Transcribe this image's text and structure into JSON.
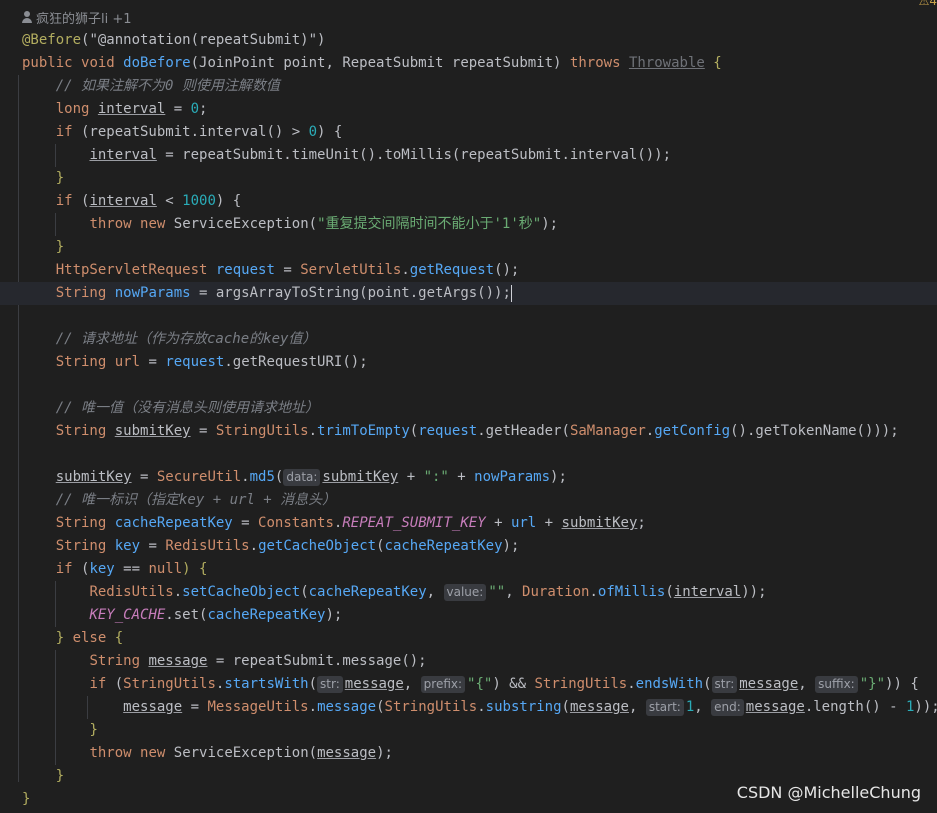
{
  "author": {
    "name": "疯狂的狮子li +1"
  },
  "warning_count": "4",
  "watermark": "CSDN @MichelleChung",
  "code": {
    "l1": {
      "ann": "@Before",
      "rest": "(\"@annotation(repeatSubmit)\")"
    },
    "l2": {
      "public": "public",
      "void": "void",
      "fn": "doBefore",
      "p1": "(JoinPoint point, RepeatSubmit repeatSubmit)",
      "throws": "throws",
      "thr": "Throwable",
      "brace": " {"
    },
    "l3": {
      "comment": "// 如果注解不为0 则使用注解数值"
    },
    "l4": {
      "long": "long",
      "var": "interval",
      "eq": " = ",
      "num": "0",
      "end": ";"
    },
    "l5": {
      "if": "if",
      "a": " (repeatSubmit.interval() > ",
      "num": "0",
      "b": ") {"
    },
    "l6": {
      "var": "interval",
      "a": " = repeatSubmit.timeUnit().toMillis(repeatSubmit.interval());"
    },
    "l7": {
      "text": "}"
    },
    "l8": {
      "if": "if",
      "a": " (",
      "var": "interval",
      "b": " < ",
      "num": "1000",
      "c": ") {"
    },
    "l9": {
      "throw": "throw",
      "new": "new",
      "a": "ServiceException(",
      "str": "\"重复提交间隔时间不能小于'1'秒\"",
      "b": ");"
    },
    "l10": {
      "text": "}"
    },
    "l11": {
      "type": "HttpServletRequest",
      "var": "request",
      "a": " = ",
      "cls": "ServletUtils",
      "dot": ".",
      "fn": "getRequest",
      "b": "();"
    },
    "l12": {
      "type": "String",
      "var": "nowParams",
      "a": " = argsArrayToString(point.getArgs());"
    },
    "l13": {
      "comment": "// 请求地址（作为存放cache的key值）"
    },
    "l14": {
      "type": "String",
      "var": "url",
      "a": " = ",
      "obj": "request",
      "b": ".getRequestURI();"
    },
    "l15": {
      "comment": "// 唯一值（没有消息头则使用请求地址）"
    },
    "l16": {
      "type": "String",
      "var": "submitKey",
      "a": " = ",
      "cls": "StringUtils",
      "dot": ".",
      "fn": "trimToEmpty",
      "b": "(",
      "obj": "request",
      "c": ".getHeader(",
      "cls2": "SaManager",
      "fn2": "getConfig",
      "d": "().getTokenName()));"
    },
    "l17": {
      "var": "submitKey",
      "a": " = ",
      "cls": "SecureUtil",
      "fn": "md5",
      "hint": "data:",
      "var2": "submitKey",
      "b": " + ",
      "str": "\":\"",
      "c": " + ",
      "var3": "nowParams",
      "d": ");"
    },
    "l18": {
      "comment": "// 唯一标识（指定key + url + 消息头）"
    },
    "l19": {
      "type": "String",
      "var": "cacheRepeatKey",
      "a": " = ",
      "cls": "Constants",
      "const": "REPEAT_SUBMIT_KEY",
      "b": " + ",
      "var2": "url",
      "c": " + ",
      "var3": "submitKey",
      "d": ";"
    },
    "l20": {
      "type": "String",
      "var": "key",
      "a": " = ",
      "cls": "RedisUtils",
      "fn": "getCacheObject",
      "b": "(",
      "var2": "cacheRepeatKey",
      "c": ");"
    },
    "l21": {
      "if": "if",
      "a": " (",
      "var": "key",
      "b": " == ",
      "null": "null",
      "c": ") {"
    },
    "l22": {
      "cls": "RedisUtils",
      "fn": "setCacheObject",
      "a": "(",
      "var": "cacheRepeatKey",
      "b": ", ",
      "hint": "value:",
      "str": "\"\"",
      "c": ", ",
      "cls2": "Duration",
      "fn2": "ofMillis",
      "d": "(",
      "var2": "interval",
      "e": "));"
    },
    "l23": {
      "const": "KEY_CACHE",
      "a": ".set(",
      "var": "cacheRepeatKey",
      "b": ");"
    },
    "l24": {
      "close": "} ",
      "else": "else",
      "brace": " {"
    },
    "l25": {
      "type": "String",
      "var": "message",
      "a": " = repeatSubmit.message();"
    },
    "l26": {
      "if": "if",
      "a": " (",
      "cls": "StringUtils",
      "fn": "startsWith",
      "b": "(",
      "h1": "str:",
      "v1": "message",
      "c": ", ",
      "h2": "prefix:",
      "s1": "\"{\"",
      "d": ") && ",
      "cls2": "StringUtils",
      "fn2": "endsWith",
      "e": "(",
      "h3": "str:",
      "v2": "message",
      "f": ", ",
      "h4": "suffix:",
      "s2": "\"}\"",
      "g": ")) {"
    },
    "l27": {
      "var": "message",
      "a": " = ",
      "cls": "MessageUtils",
      "fn": "message",
      "b": "(",
      "cls2": "StringUtils",
      "fn2": "substring",
      "c": "(",
      "v1": "message",
      "d": ", ",
      "h1": "start:",
      "n1": "1",
      "e": ", ",
      "h2": "end:",
      "v2": "message",
      "f": ".length() - ",
      "n2": "1",
      "g": "));"
    },
    "l28": {
      "text": "}"
    },
    "l29": {
      "throw": "throw",
      "new": "new",
      "a": "ServiceException(",
      "var": "message",
      "b": ");"
    },
    "l30": {
      "text": "}"
    },
    "l31": {
      "text": "}"
    }
  }
}
